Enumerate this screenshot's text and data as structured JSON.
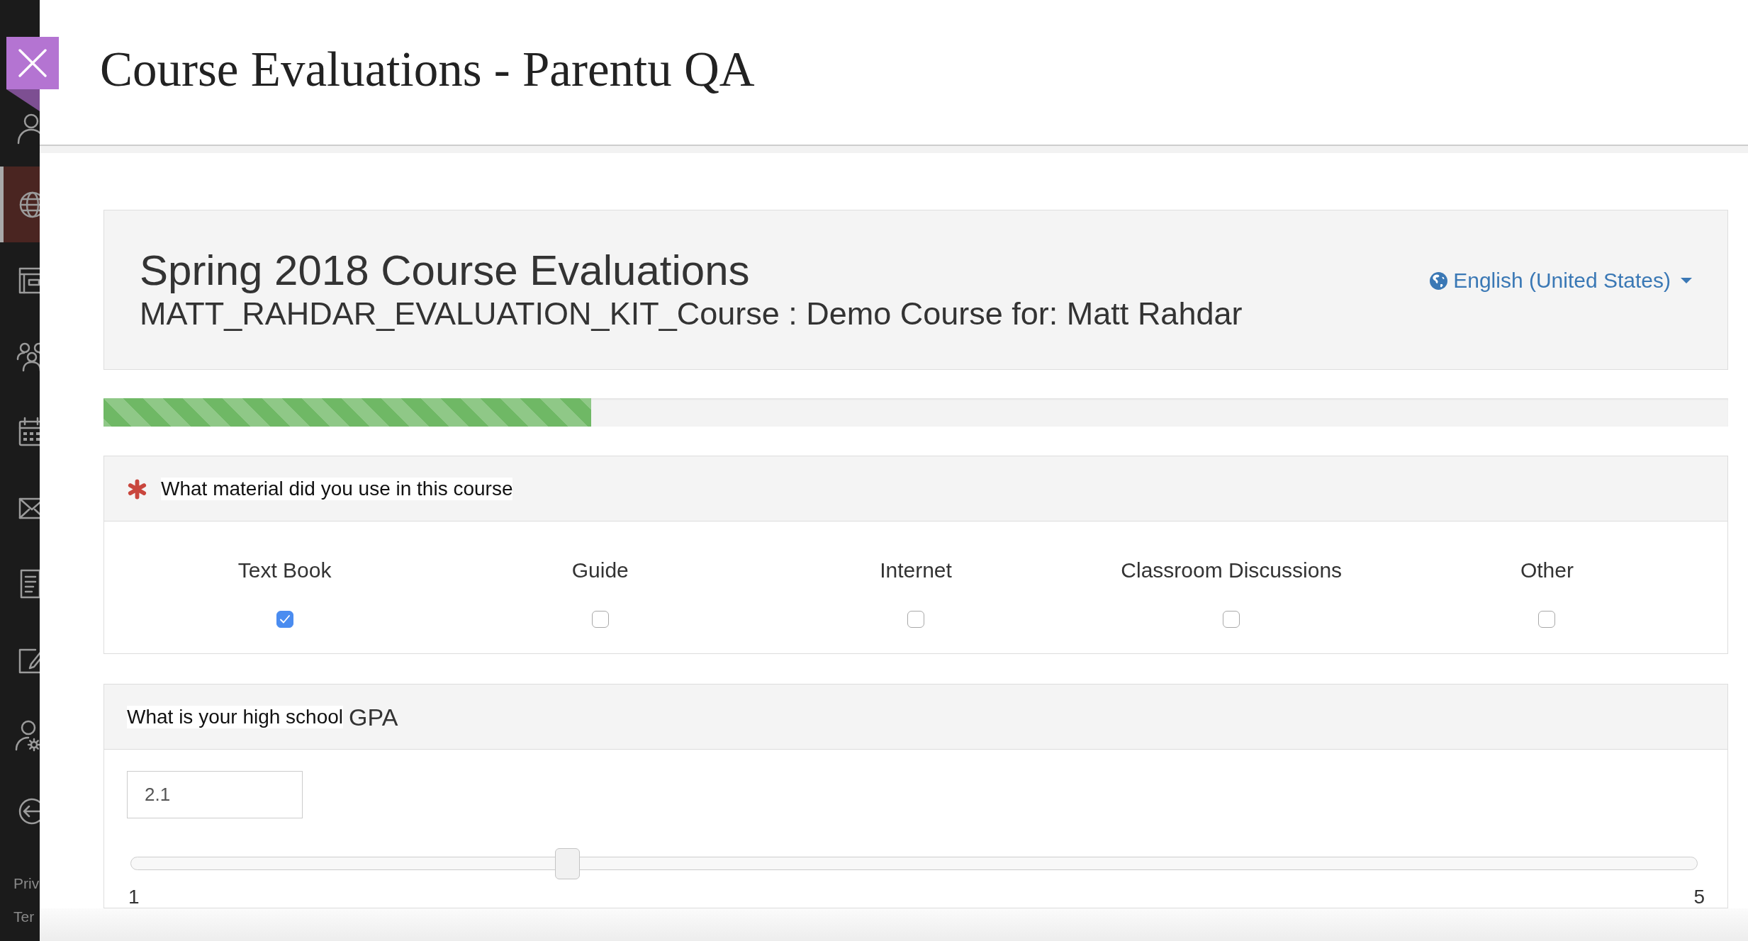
{
  "header": {
    "title": "Course Evaluations - Parentu QA"
  },
  "sidebar": {
    "items": [
      {
        "selected": false
      },
      {
        "selected": true
      },
      {
        "selected": false
      },
      {
        "selected": false
      },
      {
        "selected": false
      },
      {
        "selected": false
      },
      {
        "selected": false
      },
      {
        "selected": false
      },
      {
        "selected": false
      },
      {
        "selected": false
      }
    ],
    "footer_links": [
      "Priv",
      "Ter"
    ]
  },
  "evaluation": {
    "title": "Spring 2018 Course Evaluations",
    "subtitle": "MATT_RAHDAR_EVALUATION_KIT_Course : Demo Course for: Matt Rahdar",
    "language": "English (United States)"
  },
  "progress": {
    "level": 0.3
  },
  "questions": [
    {
      "kind": "checkboxes",
      "required": true,
      "text": "What material did you use in this course",
      "options": [
        {
          "label": "Text Book",
          "checked": true
        },
        {
          "label": "Guide",
          "checked": false
        },
        {
          "label": "Internet",
          "checked": false
        },
        {
          "label": "Classroom Discussions",
          "checked": false
        },
        {
          "label": "Other",
          "checked": false
        }
      ]
    },
    {
      "kind": "slider",
      "required": false,
      "text": "What is your high school",
      "text_emphasis": "GPA",
      "value": "2.1",
      "level": 0.275,
      "min_label": "1",
      "max_label": "5"
    }
  ]
}
